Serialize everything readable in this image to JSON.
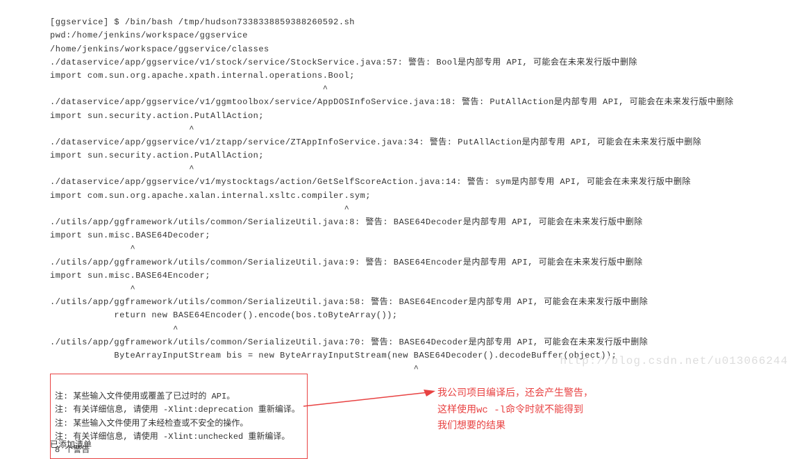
{
  "terminal": {
    "lines": [
      "[ggservice] $ /bin/bash /tmp/hudson7338338859388260592.sh",
      "pwd:/home/jenkins/workspace/ggservice",
      "/home/jenkins/workspace/ggservice/classes",
      "./dataservice/app/ggservice/v1/stock/service/StockService.java:57: 警告: Bool是内部专用 API, 可能会在未来发行版中删除",
      "import com.sun.org.apache.xpath.internal.operations.Bool;",
      "                                                   ^",
      "./dataservice/app/ggservice/v1/ggmtoolbox/service/AppDOSInfoService.java:18: 警告: PutAllAction是内部专用 API, 可能会在未来发行版中删除",
      "import sun.security.action.PutAllAction;",
      "                          ^",
      "./dataservice/app/ggservice/v1/ztapp/service/ZTAppInfoService.java:34: 警告: PutAllAction是内部专用 API, 可能会在未来发行版中删除",
      "import sun.security.action.PutAllAction;",
      "                          ^",
      "./dataservice/app/ggservice/v1/mystocktags/action/GetSelfScoreAction.java:14: 警告: sym是内部专用 API, 可能会在未来发行版中删除",
      "import com.sun.org.apache.xalan.internal.xsltc.compiler.sym;",
      "                                                       ^",
      "./utils/app/ggframework/utils/common/SerializeUtil.java:8: 警告: BASE64Decoder是内部专用 API, 可能会在未来发行版中删除",
      "import sun.misc.BASE64Decoder;",
      "               ^",
      "./utils/app/ggframework/utils/common/SerializeUtil.java:9: 警告: BASE64Encoder是内部专用 API, 可能会在未来发行版中删除",
      "import sun.misc.BASE64Encoder;",
      "               ^",
      "./utils/app/ggframework/utils/common/SerializeUtil.java:58: 警告: BASE64Encoder是内部专用 API, 可能会在未来发行版中删除",
      "            return new BASE64Encoder().encode(bos.toByteArray());",
      "                       ^",
      "./utils/app/ggframework/utils/common/SerializeUtil.java:70: 警告: BASE64Decoder是内部专用 API, 可能会在未来发行版中删除",
      "            ByteArrayInputStream bis = new ByteArrayInputStream(new BASE64Decoder().decodeBuffer(object));",
      "                                                                    ^"
    ]
  },
  "notes": {
    "lines": [
      "注: 某些输入文件使用或覆盖了已过时的 API。",
      "注: 有关详细信息, 请使用 -Xlint:deprecation 重新编译。",
      "注: 某些输入文件使用了未经检查或不安全的操作。",
      "注: 有关详细信息, 请使用 -Xlint:unchecked 重新编译。",
      "8 个警告"
    ]
  },
  "post_notes": "已添加清单",
  "annotation": {
    "lines": [
      "我公司项目编译后，还会产生警告，",
      "这样使用wc -l命令时就不能得到",
      "我们想要的结果"
    ]
  },
  "watermark": "http://blog.csdn.net/u013066244"
}
